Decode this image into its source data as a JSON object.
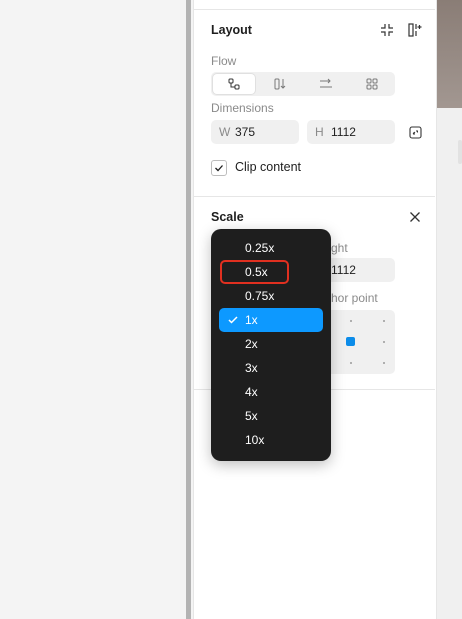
{
  "layout": {
    "title": "Layout",
    "flow_label": "Flow",
    "dimensions_label": "Dimensions",
    "width_prefix": "W",
    "width_value": "375",
    "height_prefix": "H",
    "height_value": "1112",
    "clip_label": "Clip content",
    "clip_checked": true
  },
  "scale": {
    "title": "Scale",
    "height_label_partial": "ght",
    "height_value": "1112",
    "anchor_label_partial": "hor point",
    "selected": "1x",
    "highlighted": "0.5x",
    "options": [
      "0.25x",
      "0.5x",
      "0.75x",
      "1x",
      "2x",
      "3x",
      "4x",
      "5x",
      "10x"
    ]
  },
  "colors": {
    "accent": "#0d99ff",
    "anchor": "#0c8ce9",
    "highlight_border": "#e03020",
    "menu_bg": "#1e1e1e"
  }
}
